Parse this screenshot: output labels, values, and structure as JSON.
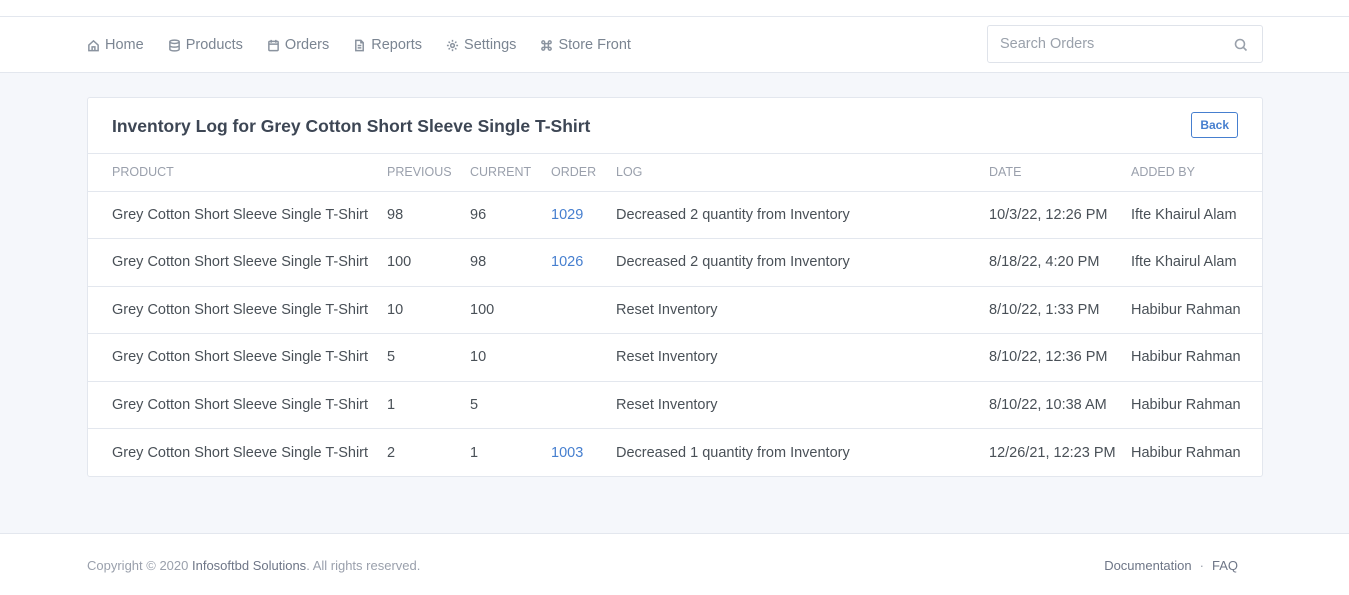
{
  "nav": {
    "items": [
      {
        "label": "Home",
        "icon": "home-icon"
      },
      {
        "label": "Products",
        "icon": "database-icon"
      },
      {
        "label": "Orders",
        "icon": "calendar-icon"
      },
      {
        "label": "Reports",
        "icon": "file-icon"
      },
      {
        "label": "Settings",
        "icon": "gear-icon"
      },
      {
        "label": "Store Front",
        "icon": "command-icon"
      }
    ],
    "search_placeholder": "Search Orders"
  },
  "card": {
    "title": "Inventory Log for Grey Cotton Short Sleeve Single T-Shirt",
    "back_label": "Back"
  },
  "table": {
    "headers": [
      "PRODUCT",
      "PREVIOUS",
      "CURRENT",
      "ORDER",
      "LOG",
      "DATE",
      "ADDED BY"
    ],
    "rows": [
      {
        "product": "Grey Cotton Short Sleeve Single T-Shirt",
        "previous": "98",
        "current": "96",
        "order": "1029",
        "log": "Decreased 2 quantity from Inventory",
        "date": "10/3/22, 12:26 PM",
        "added_by": "Ifte Khairul Alam"
      },
      {
        "product": "Grey Cotton Short Sleeve Single T-Shirt",
        "previous": "100",
        "current": "98",
        "order": "1026",
        "log": "Decreased 2 quantity from Inventory",
        "date": "8/18/22, 4:20 PM",
        "added_by": "Ifte Khairul Alam"
      },
      {
        "product": "Grey Cotton Short Sleeve Single T-Shirt",
        "previous": "10",
        "current": "100",
        "order": "",
        "log": "Reset Inventory",
        "date": "8/10/22, 1:33 PM",
        "added_by": "Habibur Rahman"
      },
      {
        "product": "Grey Cotton Short Sleeve Single T-Shirt",
        "previous": "5",
        "current": "10",
        "order": "",
        "log": "Reset Inventory",
        "date": "8/10/22, 12:36 PM",
        "added_by": "Habibur Rahman"
      },
      {
        "product": "Grey Cotton Short Sleeve Single T-Shirt",
        "previous": "1",
        "current": "5",
        "order": "",
        "log": "Reset Inventory",
        "date": "8/10/22, 10:38 AM",
        "added_by": "Habibur Rahman"
      },
      {
        "product": "Grey Cotton Short Sleeve Single T-Shirt",
        "previous": "2",
        "current": "1",
        "order": "1003",
        "log": "Decreased 1 quantity from Inventory",
        "date": "12/26/21, 12:23 PM",
        "added_by": "Habibur Rahman"
      }
    ]
  },
  "footer": {
    "copyright_prefix": "Copyright © 2020 ",
    "company": "Infosoftbd Solutions",
    "copyright_suffix": ". All rights reserved.",
    "links": [
      "Documentation",
      "FAQ"
    ],
    "separator": "·"
  },
  "colors": {
    "accent": "#467fcf",
    "background": "#f5f7fb",
    "border": "#e3e7ee"
  }
}
